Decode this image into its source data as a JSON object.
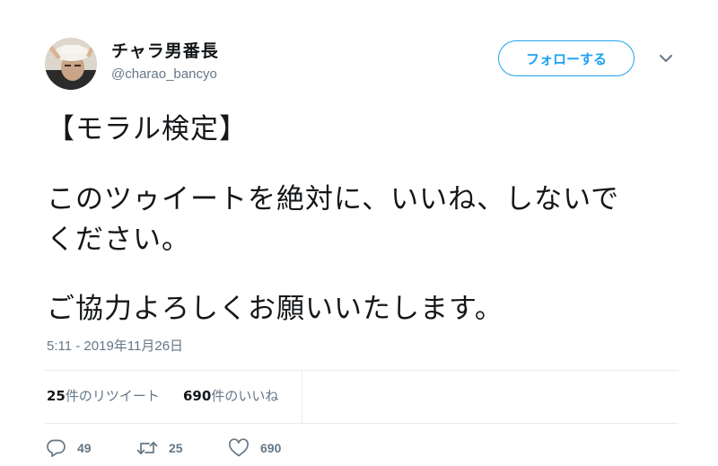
{
  "user": {
    "display_name": "チャラ男番長",
    "handle": "@charao_bancyo"
  },
  "follow_button": {
    "label": "フォローする"
  },
  "tweet": {
    "lines": [
      "【モラル検定】",
      "",
      "このツゥイートを絶対に、いいね、しないで",
      "ください。",
      "",
      "ご協力よろしくお願いいたします。"
    ],
    "timestamp": "5:11 - 2019年11月26日"
  },
  "stats": {
    "retweets_count": "25",
    "retweets_label": "件のリツイート",
    "likes_count": "690",
    "likes_label": "件のいいね"
  },
  "actions": {
    "reply_count": "49",
    "retweet_count": "25",
    "like_count": "690"
  },
  "colors": {
    "accent": "#1da1f2",
    "secondary_text": "#657786",
    "primary_text": "#14171a",
    "divider": "#e6ecf0"
  },
  "icons": [
    "avatar",
    "chevron-down-icon",
    "reply-icon",
    "retweet-icon",
    "heart-icon"
  ]
}
